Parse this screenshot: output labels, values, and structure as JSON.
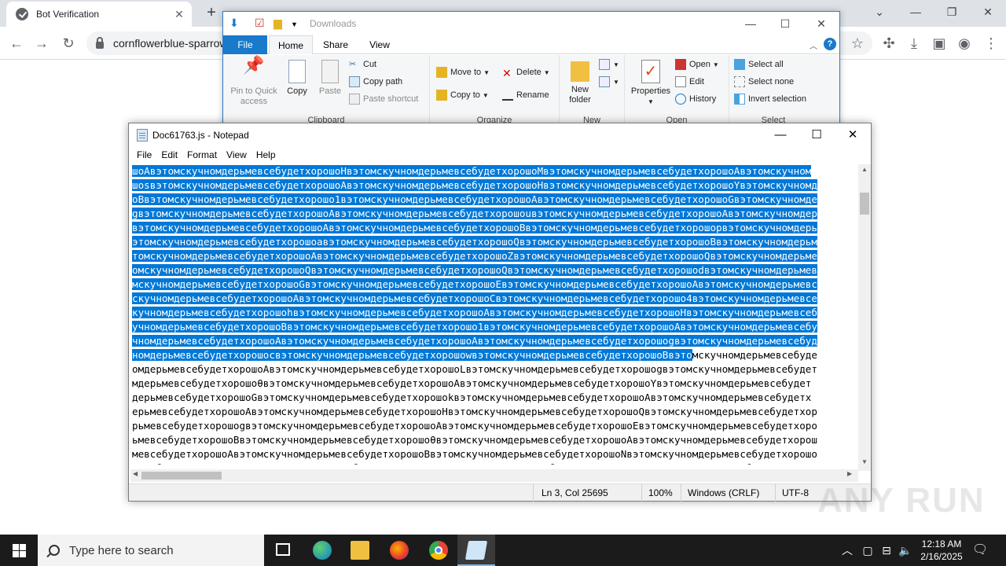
{
  "browser": {
    "tab_title": "Bot Verification",
    "tab_close": "✕",
    "new_tab": "+",
    "url": "cornflowerblue-sparrow",
    "back": "←",
    "forward": "→",
    "reload": "↻",
    "window_controls": {
      "dropdown": "⌄",
      "minimize": "—",
      "restore": "❐",
      "close": "✕"
    }
  },
  "explorer": {
    "window_title": "Downloads",
    "tabs": {
      "file": "File",
      "home": "Home",
      "share": "Share",
      "view": "View"
    },
    "clipboard": {
      "pin": "Pin to Quick access",
      "copy": "Copy",
      "paste": "Paste",
      "cut": "Cut",
      "copy_path": "Copy path",
      "paste_shortcut": "Paste shortcut",
      "label": "Clipboard"
    },
    "organize": {
      "move_to": "Move to",
      "copy_to": "Copy to",
      "delete": "Delete",
      "rename": "Rename",
      "label": "Organize"
    },
    "new": {
      "new_folder": "New folder",
      "label": "New"
    },
    "open": {
      "properties": "Properties",
      "open": "Open",
      "edit": "Edit",
      "history": "History",
      "label": "Open"
    },
    "select": {
      "select_all": "Select all",
      "select_none": "Select none",
      "invert": "Invert selection",
      "label": "Select"
    }
  },
  "notepad": {
    "title": "Doc61763.js - Notepad",
    "menu": {
      "file": "File",
      "edit": "Edit",
      "format": "Format",
      "view": "View",
      "help": "Help"
    },
    "selected_lines": [
      "шоАвэтомскучномдерьмевсебудетхорошоНвэтомскучномдерьмевсебудетхорошоМвэтомскучномдерьмевсебудетхорошоАвэтомскучном",
      "шоsвэтомскучномдерьмевсебудетхорошоАвэтомскучномдерьмевсебудетхорошоНвэтомскучномдерьмевсебудетхорошоYвэтомскучномд",
      "оВвэтомскучномдерьмевсебудетхорошо1вэтомскучномдерьмевсебудетхорошоАвэтомскучномдерьмевсебудетхорошоGвэтомскучномде",
      "gвэтомскучномдерьмевсебудетхорошоАвэтомскучномдерьмевсебудетхорошоuвэтомскучномдерьмевсебудетхорошоАвэтомскучномдер",
      "вэтомскучномдерьмевсебудетхорошоАвэтомскучномдерьмевсебудетхорошоВвэтомскучномдерьмевсебудетхорошоpвэтомскучномдерь",
      "этомскучномдерьмевсебудетхорошоaвэтомскучномдерьмевсебудетхорошоQвэтомскучномдерьмевсебудетхорошоВвэтомскучномдерьм",
      "томскучномдерьмевсебудетхорошоАвэтомскучномдерьмевсебудетхорошоZвэтомскучномдерьмевсебудетхорошоQвэтомскучномдерьме",
      "омскучномдерьмевсебудетхорошоQвэтомскучномдерьмевсебудетхорошоQвэтомскучномдерьмевсебудетхорошоdвэтомскучномдерьмев",
      "мскучномдерьмевсебудетхорошоGвэтомскучномдерьмевсебудетхорошоEвэтомскучномдерьмевсебудетхорошоАвэтомскучномдерьмевс",
      "скучномдерьмевсебудетхорошоАвэтомскучномдерьмевсебудетхорошоCвэтомскучномдерьмевсебудетхорошо4вэтомскучномдерьмевсе",
      "кучномдерьмевсебудетхорошоhвэтомскучномдерьмевсебудетхорошоАвэтомскучномдерьмевсебудетхорошоНвэтомскучномдерьмевсеб",
      "учномдерьмевсебудетхорошоВвэтомскучномдерьмевсебудетхорошо1вэтомскучномдерьмевсебудетхорошоАвэтомскучномдерьмевсебу",
      "чномдерьмевсебудетхорошоАвэтомскучномдерьмевсебудетхорошоАвэтомскучномдерьмевсебудетхорошоgвэтомскучномдерьмевсебуд"
    ],
    "partial_line_selected": "номдерьмевсебудетхорошоcвэтомскучномдерьмевсебудетхорошоwвэтомскучномдерьмевсебудетхорошоВвэто",
    "partial_line_rest": "мскучномдерьмевсебуде",
    "unselected_lines": [
      "омдерьмевсебудетхорошоАвэтомскучномдерьмевсебудетхорошоLвэтомскучномдерьмевсебудетхорошоgвэтомскучномдерьмевсебудет",
      "мдерьмевсебудетхорошоθвэтомскучномдерьмевсебудетхорошоАвэтомскучномдерьмевсебудетхорошоYвэтомскучномдерьмевсебудет",
      "дерьмевсебудетхорошоGвэтомскучномдерьмевсебудетхорошоkвэтомскучномдерьмевсебудетхорошоАвэтомскучномдерьмевсебудетх",
      "ерьмевсебудетхорошоАвэтомскучномдерьмевсебудетхорошоНвэтомскучномдерьмевсебудетхорошоQвэтомскучномдерьмевсебудетхор",
      "рьмевсебудетхорошоgвэтомскучномдерьмевсебудетхорошоАвэтомскучномдерьмевсебудетхорошоEвэтомскучномдерьмевсебудетхоро",
      "ьмевсебудетхорошоВвэтомскучномдерьмевсебудетхорошоθвэтомскучномдерьмевсебудетхорошоАвэтомскучномдерьмевсебудетхорош",
      "мевсебудетхорошоАвэтомскучномдерьмевсебудетхорошоВвэтомскучномдерьмевсебудетхорошоNвэтомскучномдерьмевсебудетхорошо",
      "евсебудетхорошоaвэтомскучномдерьмевсебудетхорошоQвэтомскучномдерьмевсебудетхорошоВвэтомскучномдерьмевсебудетхорошоx"
    ],
    "status": {
      "position": "Ln 3, Col 25695",
      "zoom": "100%",
      "line_ending": "Windows (CRLF)",
      "encoding": "UTF-8"
    },
    "controls": {
      "minimize": "—",
      "maximize": "☐",
      "close": "✕"
    }
  },
  "watermark": "ANY RUN",
  "taskbar": {
    "search_placeholder": "Type here to search",
    "time": "12:18 AM",
    "date": "2/16/2025"
  },
  "colors": {
    "selection": "#0078d7",
    "explorer_file_tab": "#1979ca",
    "taskbar": "#1b1b1b"
  }
}
